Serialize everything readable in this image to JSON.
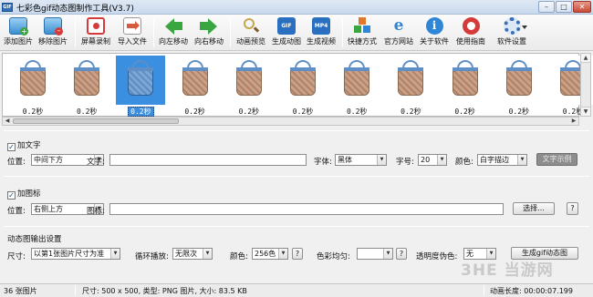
{
  "window": {
    "icon_text": "GIF",
    "title": "七彩色gif动态图制作工具(V3.7)",
    "min_glyph": "–",
    "max_glyph": "□",
    "close_glyph": "✕"
  },
  "toolbar": {
    "buttons": [
      {
        "label": "添加图片",
        "icon": "add-image-icon",
        "color": "#3a8fd0"
      },
      {
        "label": "移除图片",
        "icon": "remove-image-icon",
        "color": "#3a8fd0"
      },
      {
        "label": "屏幕录制",
        "icon": "screen-record-icon",
        "color": "#d63b3b"
      },
      {
        "label": "导入文件",
        "icon": "import-file-icon",
        "color": "#d65a3b"
      },
      {
        "label": "向左移动",
        "icon": "arrow-left-icon",
        "color": "#3aa640"
      },
      {
        "label": "向右移动",
        "icon": "arrow-right-icon",
        "color": "#3aa640"
      },
      {
        "label": "动画预览",
        "icon": "preview-magnifier-icon",
        "color": "#c9a64a"
      },
      {
        "label": "生成动图",
        "icon": "gif-icon",
        "color": "#2a6fc0",
        "badge": "GIF"
      },
      {
        "label": "生成视频",
        "icon": "mp4-icon",
        "color": "#2a6fc0",
        "badge": "MP4"
      },
      {
        "label": "快捷方式",
        "icon": "shortcut-cubes-icon",
        "color": "#e0792a"
      },
      {
        "label": "官方网站",
        "icon": "website-ie-icon",
        "color": "#2f85d6"
      },
      {
        "label": "关于软件",
        "icon": "info-icon",
        "color": "#2f85d6"
      },
      {
        "label": "使用指南",
        "icon": "guide-lifebuoy-icon",
        "color": "#d63b3b"
      },
      {
        "label": "软件设置",
        "icon": "settings-gear-icon",
        "color": "#3a6fb5"
      }
    ]
  },
  "frames": {
    "duration_label": "0.2秒",
    "count_visible": 11,
    "selected_index": 2
  },
  "text_section": {
    "checkbox_label": "加文字",
    "checked": true,
    "position_label": "位置:",
    "position_value": "中间下方",
    "text_label": "文字:",
    "text_value": "",
    "font_label": "字体:",
    "font_value": "黑体",
    "size_label": "字号:",
    "size_value": "20",
    "color_label": "颜色:",
    "color_value": "白字描边",
    "sample_button": "文字示例"
  },
  "icon_section": {
    "checkbox_label": "加图标",
    "checked": true,
    "position_label": "位置:",
    "position_value": "右侧上方",
    "icon_label": "图标:",
    "icon_value": "",
    "browse_button": "选择...",
    "help_button": "?"
  },
  "output_section": {
    "heading": "动态图输出设置",
    "size_label": "尺寸:",
    "size_value": "以第1张图片尺寸为准",
    "loop_label": "循环播放:",
    "loop_value": "无限次",
    "color_label": "颜色:",
    "color_value": "256色",
    "color_help": "?",
    "dither_label": "色彩均匀:",
    "dither_value": "",
    "dither_help": "?",
    "transparency_label": "透明度伪色:",
    "transparency_value": "无",
    "generate_button": "生成gif动态图"
  },
  "status": {
    "count": "36 张图片",
    "info": "尺寸: 500 x 500, 类型: PNG 图片, 大小: 83.5 KB",
    "duration": "动画长度: 00:00:07.199"
  },
  "watermark": "3HE 当游网"
}
